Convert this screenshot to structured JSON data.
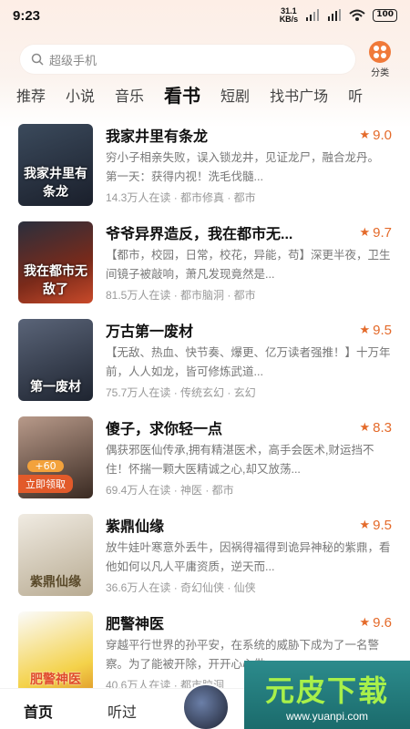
{
  "status": {
    "time": "9:23",
    "speed_value": "31.1",
    "speed_unit": "KB/s",
    "battery": "100"
  },
  "search": {
    "placeholder": "超级手机",
    "category_label": "分类"
  },
  "tabs": [
    "推荐",
    "小说",
    "音乐",
    "看书",
    "短剧",
    "找书广场",
    "听"
  ],
  "active_tab": "看书",
  "books": [
    {
      "title": "我家井里有条龙",
      "score": "9.0",
      "desc": "穷小子相亲失败，误入锁龙井，见证龙尸，融合龙丹。　　第一天：获得内视！洗毛伐髓...",
      "meta": "14.3万人在读 · 都市修真 · 都市",
      "cover_text": "我家井里有条龙",
      "cover_colors": [
        "#3b4a5c",
        "#1a1f2b"
      ]
    },
    {
      "title": "爷爷异界造反，我在都市无...",
      "score": "9.7",
      "desc": "【都市，校园，日常，校花，异能，苟】深更半夜，卫生间镜子被敲响，萧凡发现竟然是...",
      "meta": "81.5万人在读 · 都市脑洞 · 都市",
      "cover_text": "我在都市无敌了",
      "cover_colors": [
        "#c94a2a",
        "#3a1a14"
      ]
    },
    {
      "title": "万古第一废材",
      "score": "9.5",
      "desc": "【无敌、热血、快节奏、爆更、亿万读者强推！】十万年前，人人如龙，皆可修炼武道...",
      "meta": "75.7万人在读 · 传统玄幻 · 玄幻",
      "cover_text": "第一废材",
      "cover_colors": [
        "#4a5568",
        "#1e2430"
      ]
    },
    {
      "title": "傻子，求你轻一点",
      "score": "8.3",
      "desc": "偶获邪医仙传承,拥有精湛医术，高手会医术,财运挡不住！怀揣一颗大医精诚之心,却又放荡...",
      "meta": "69.4万人在读 · 神医 · 都市",
      "cover_text": "",
      "cover_colors": [
        "#8a6a5a",
        "#3a2a22"
      ],
      "reward_amount": "+60",
      "reward_button": "立即领取"
    },
    {
      "title": "紫鼎仙缘",
      "score": "9.5",
      "desc": "放牛娃叶寒意外丢牛，因祸得福得到诡异神秘的紫鼎，看他如何以凡人平庸资质，逆天而...",
      "meta": "36.6万人在读 · 奇幻仙侠 · 仙侠",
      "cover_text": "紫鼎仙缘",
      "cover_colors": [
        "#e8e2d6",
        "#b8ab92"
      ]
    },
    {
      "title": "肥警神医",
      "score": "9.6",
      "desc": "穿越平行世界的孙平安，在系统的威胁下成为了一名警察。为了能被开除，开开心心做一...",
      "meta": "40.6万人在读 · 都市脑洞",
      "cover_text": "肥警神医",
      "cover_colors": [
        "#f4d24a",
        "#e09a2a"
      ]
    }
  ],
  "bottom_nav": {
    "home": "首页",
    "listened": "听过"
  },
  "watermark": {
    "logo": "元皮下载",
    "url": "www.yuanpi.com"
  },
  "colors": {
    "accent": "#e46a2a",
    "score": "#e46a2a"
  }
}
